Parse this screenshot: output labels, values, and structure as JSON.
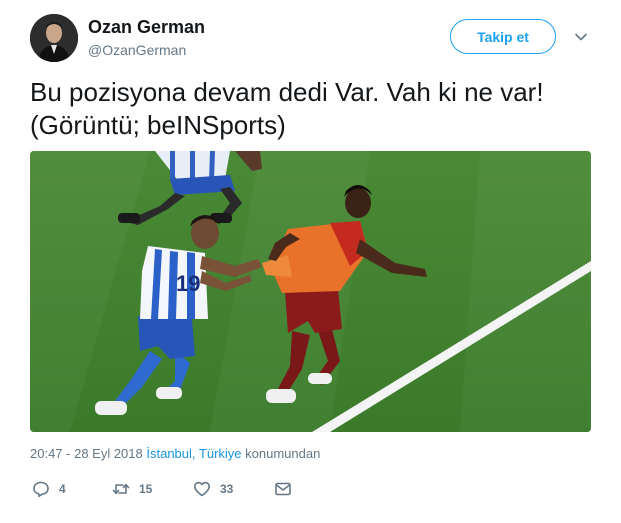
{
  "user": {
    "display_name": "Ozan German",
    "screen_name": "@OzanGerman",
    "avatar_icon": "profile-photo"
  },
  "follow_button": {
    "label": "Takip et",
    "color": "#1da1f2"
  },
  "caret_icon": "chevron-down-icon",
  "tweet": {
    "text_line1": "Bu pozisyona devam dedi Var. Vah ki ne var!",
    "text_line2": "(Görüntü; beINSports)"
  },
  "media": {
    "description_icon": "football-match-photo"
  },
  "meta": {
    "time": "20:47 - 28 Eyl 2018",
    "place": "İstanbul, Türkiye",
    "suffix": "konumundan"
  },
  "actions": {
    "reply_count": "4",
    "retweet_count": "15",
    "like_count": "33"
  },
  "colors": {
    "accent": "#1da1f2",
    "secondary_text": "#657786",
    "link": "#1b95e0"
  }
}
